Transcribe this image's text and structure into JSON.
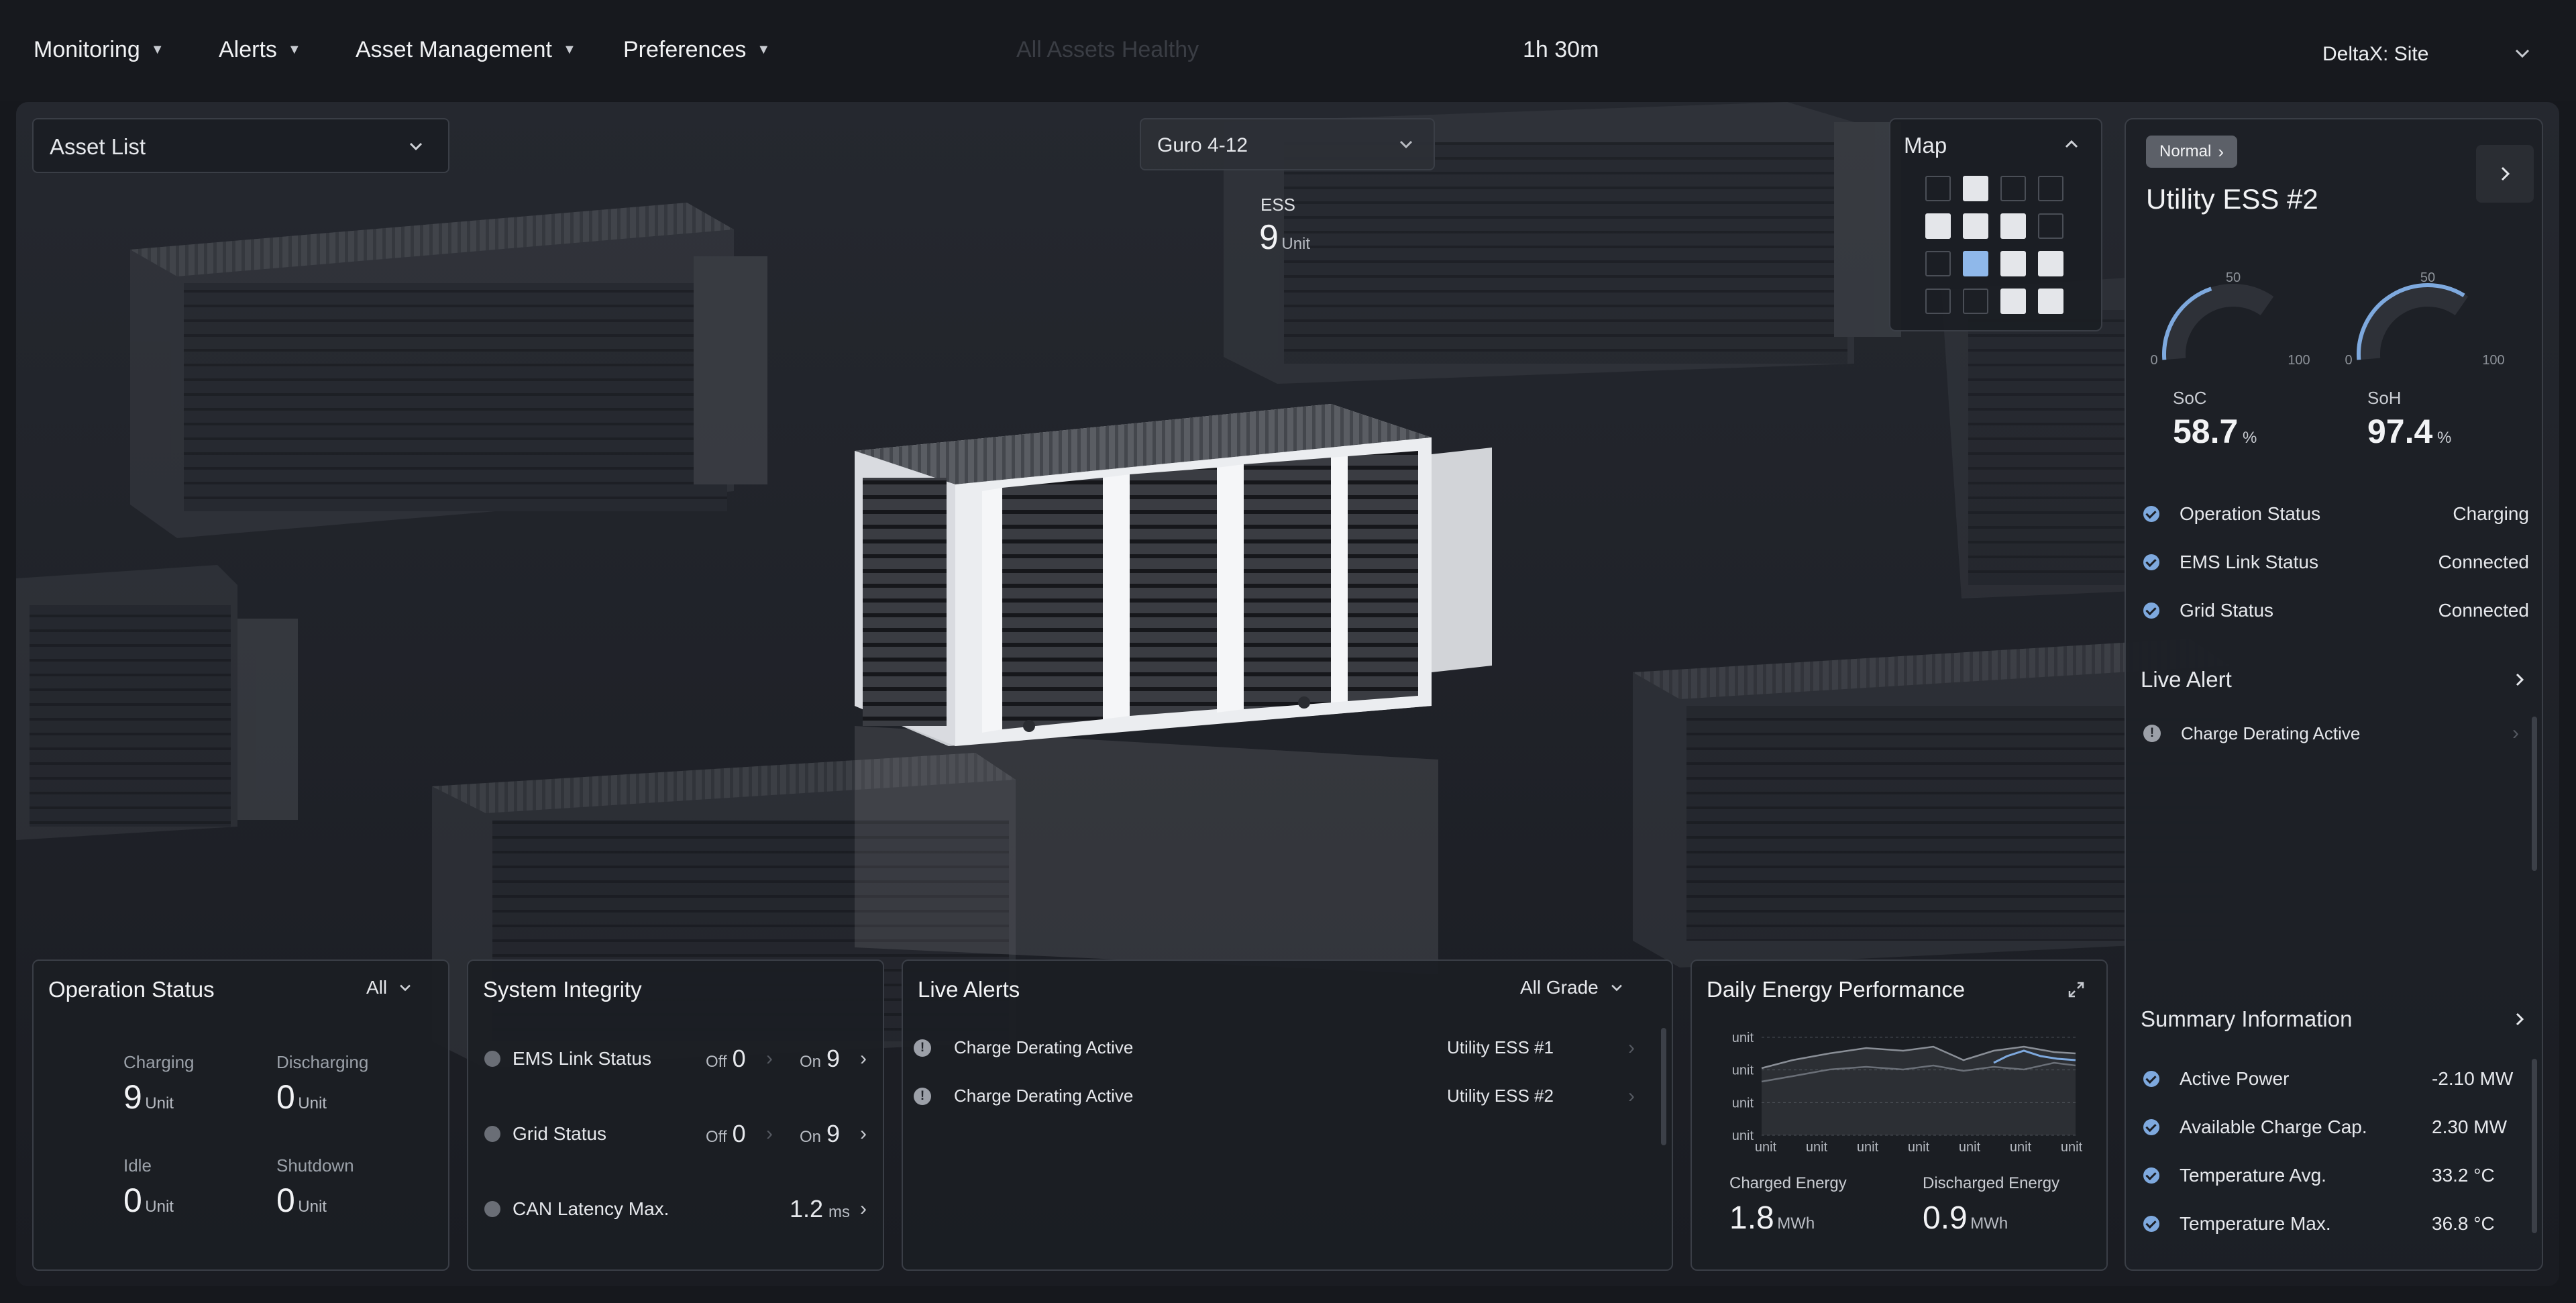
{
  "nav": {
    "menus": [
      "Monitoring",
      "Alerts",
      "Asset Management",
      "Preferences"
    ],
    "center_status": "All Assets Healthy",
    "timer": "1h 30m",
    "site": "DeltaX: Site"
  },
  "asset_list": {
    "label": "Asset List"
  },
  "group_select": {
    "value": "Guro 4-12"
  },
  "ess_count": {
    "label": "ESS",
    "value": "9",
    "unit": "Unit"
  },
  "map": {
    "title": "Map",
    "cells": [
      [
        "empty",
        "filled",
        "empty",
        "empty"
      ],
      [
        "filled",
        "filled",
        "filled",
        "empty"
      ],
      [
        "empty",
        "selected",
        "filled",
        "filled"
      ],
      [
        "empty",
        "empty",
        "filled",
        "filled"
      ]
    ]
  },
  "operation_status": {
    "title": "Operation Status",
    "filter": "All",
    "items": [
      {
        "label": "Charging",
        "value": "9",
        "unit": "Unit"
      },
      {
        "label": "Discharging",
        "value": "0",
        "unit": "Unit"
      },
      {
        "label": "Idle",
        "value": "0",
        "unit": "Unit"
      },
      {
        "label": "Shutdown",
        "value": "0",
        "unit": "Unit"
      }
    ]
  },
  "system_integrity": {
    "title": "System Integrity",
    "rows": [
      {
        "label": "EMS Link Status",
        "off_label": "Off",
        "off_value": "0",
        "on_label": "On",
        "on_value": "9"
      },
      {
        "label": "Grid Status",
        "off_label": "Off",
        "off_value": "0",
        "on_label": "On",
        "on_value": "9"
      }
    ],
    "latency": {
      "label": "CAN Latency Max.",
      "value": "1.2",
      "unit": "ms"
    }
  },
  "live_alerts": {
    "title": "Live Alerts",
    "filter": "All Grade",
    "items": [
      {
        "message": "Charge Derating Active",
        "asset": "Utility ESS #1"
      },
      {
        "message": "Charge Derating Active",
        "asset": "Utility ESS #2"
      }
    ]
  },
  "daily_energy": {
    "title": "Daily Energy Performance",
    "y_ticks": [
      "unit",
      "unit",
      "unit",
      "unit"
    ],
    "x_ticks": [
      "unit",
      "unit",
      "unit",
      "unit",
      "unit",
      "unit",
      "unit"
    ],
    "charged": {
      "label": "Charged Energy",
      "value": "1.8",
      "unit": "MWh"
    },
    "discharged": {
      "label": "Discharged Energy",
      "value": "0.9",
      "unit": "MWh"
    }
  },
  "detail": {
    "badge": "Normal",
    "title": "Utility ESS #2",
    "gauges": [
      {
        "label": "SoC",
        "value": "58.7",
        "unit": "%",
        "min": "0",
        "mid": "50",
        "max": "100",
        "fraction": 0.587
      },
      {
        "label": "SoH",
        "value": "97.4",
        "unit": "%",
        "min": "0",
        "mid": "50",
        "max": "100",
        "fraction": 0.974
      }
    ],
    "status": [
      {
        "label": "Operation Status",
        "value": "Charging"
      },
      {
        "label": "EMS Link Status",
        "value": "Connected"
      },
      {
        "label": "Grid Status",
        "value": "Connected"
      }
    ],
    "live_alert_title": "Live Alert",
    "live_alert_item": "Charge Derating Active",
    "summary_title": "Summary Information",
    "summary": [
      {
        "label": "Active Power",
        "value": "-2.10 MW"
      },
      {
        "label": "Available Charge Cap.",
        "value": "2.30 MW"
      },
      {
        "label": "Temperature Avg.",
        "value": "33.2 °C"
      },
      {
        "label": "Temperature Max.",
        "value": "36.8 °C"
      }
    ]
  },
  "colors": {
    "accent": "#7ea9de",
    "map_selected": "#8fb8ea",
    "map_filled": "#e4e6ea"
  }
}
